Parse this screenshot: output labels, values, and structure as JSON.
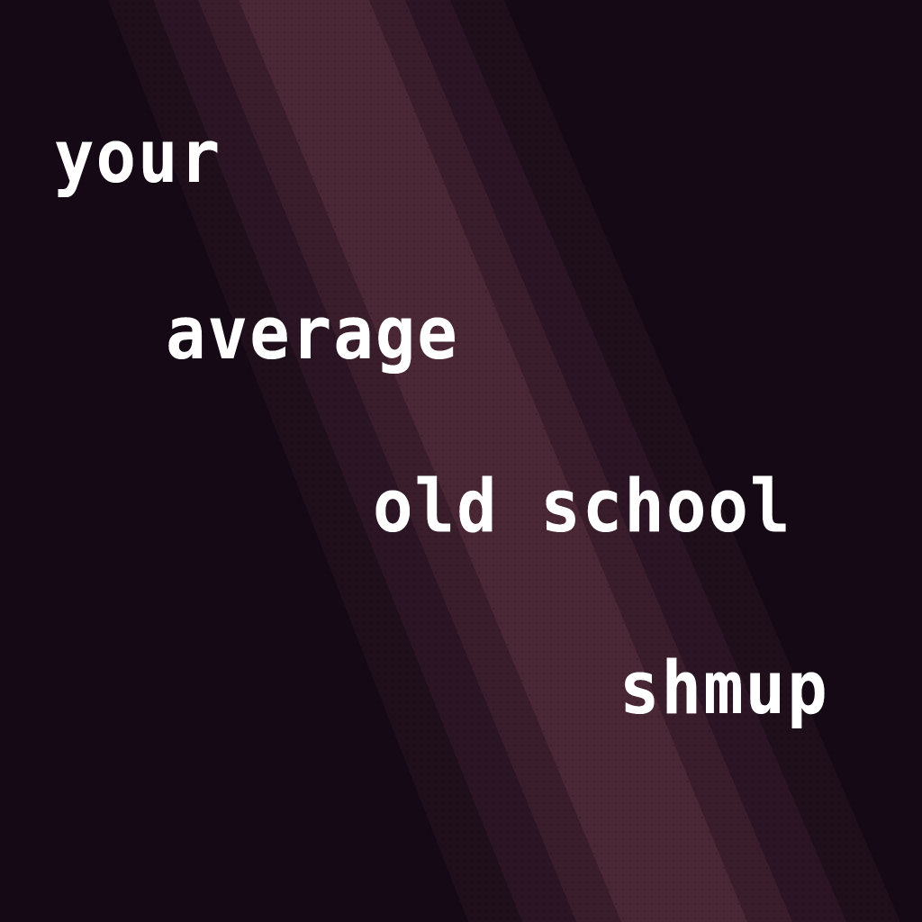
{
  "title_screen": {
    "words": [
      "your",
      "average",
      "old school",
      "shmup"
    ]
  },
  "colors": {
    "background": "#140914",
    "band_edge": "#2a1422",
    "band_mid": "#3c1e2c",
    "band_core": "#4e2a38",
    "text": "#ffffff"
  }
}
